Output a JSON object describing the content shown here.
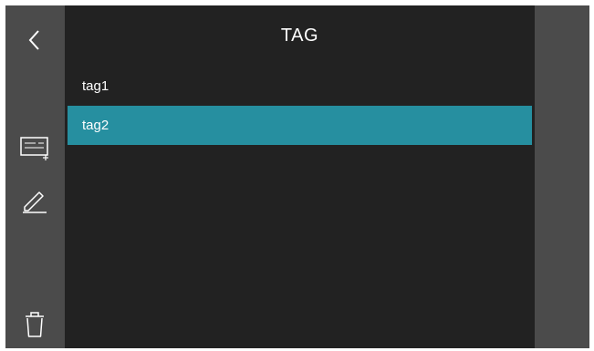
{
  "header": {
    "title": "TAG"
  },
  "toolbar": {
    "back_icon": "chevron-left-icon",
    "add_icon": "add-tag-icon",
    "edit_icon": "pencil-icon",
    "delete_icon": "trash-icon"
  },
  "tags": {
    "items": [
      {
        "label": "tag1",
        "selected": false
      },
      {
        "label": "tag2",
        "selected": true
      }
    ]
  },
  "colors": {
    "selected": "#268fa0",
    "panel": "#222222",
    "sidebar": "#4b4b4b"
  }
}
